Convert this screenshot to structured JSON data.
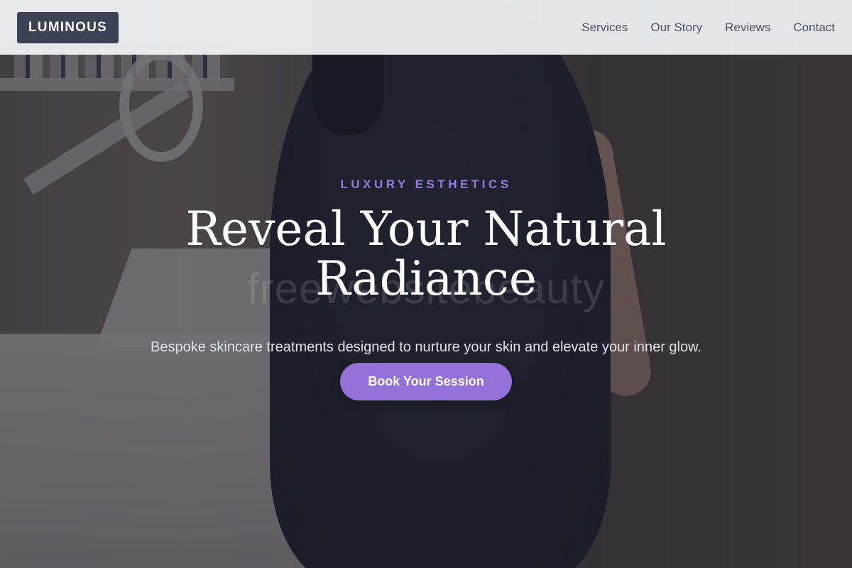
{
  "brand": {
    "logo_text": "LUMINOUS"
  },
  "nav": {
    "items": [
      {
        "label": "Services"
      },
      {
        "label": "Our Story"
      },
      {
        "label": "Reviews"
      },
      {
        "label": "Contact"
      }
    ]
  },
  "hero": {
    "eyebrow": "LUXURY ESTHETICS",
    "headline": "Reveal Your Natural Radiance",
    "subtitle": "Bespoke skincare treatments designed to nurture your skin and elevate your inner glow.",
    "cta_label": "Book Your Session",
    "watermark_text": "freewebsitebeauty"
  },
  "colors": {
    "accent": "#9470d9",
    "eyebrow": "#9b7be0",
    "logo_bg": "#3b4253",
    "header_bg": "#f3f4f6",
    "nav_text": "#4b5563"
  }
}
